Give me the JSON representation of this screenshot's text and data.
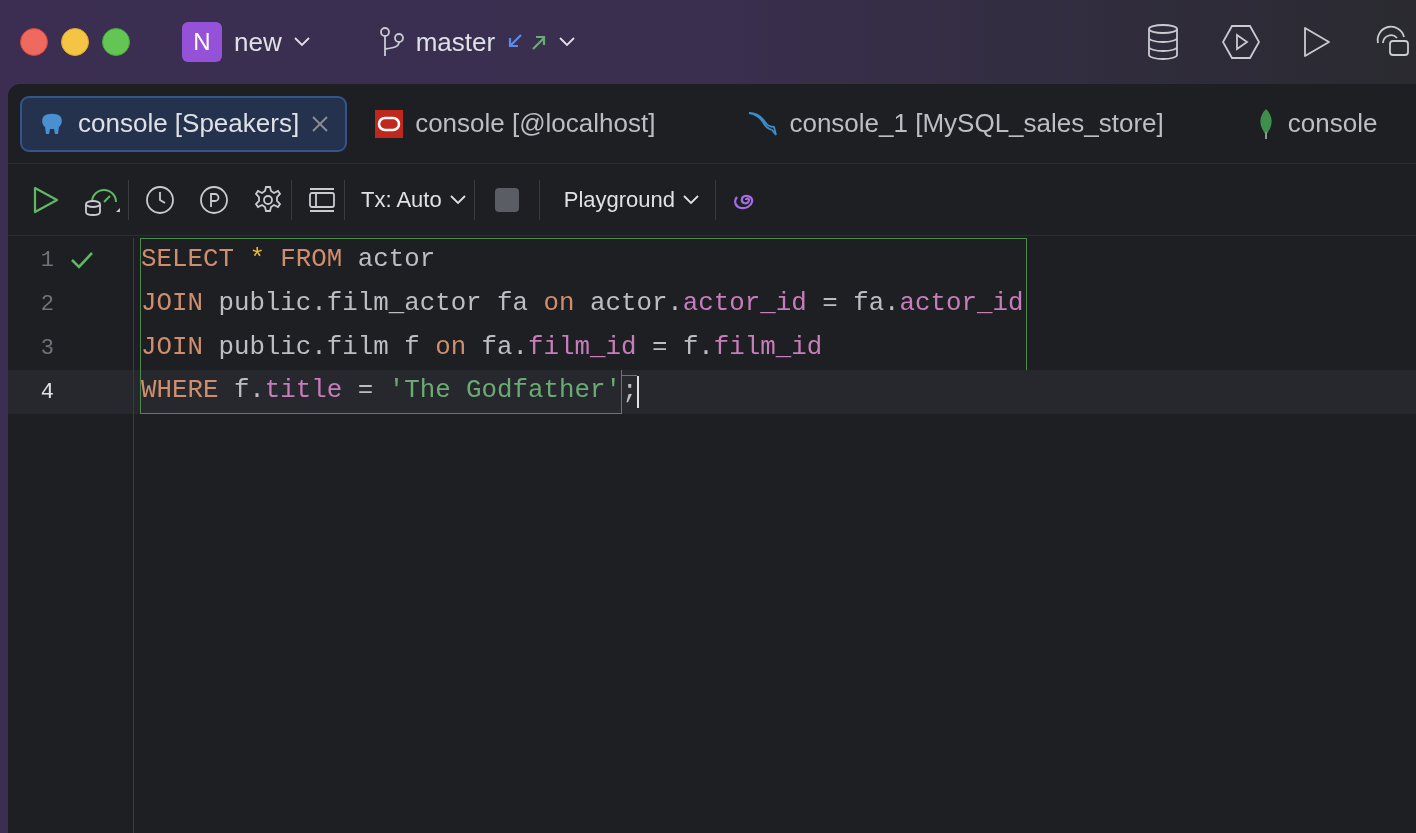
{
  "project": {
    "initial": "N",
    "name": "new"
  },
  "branch": {
    "name": "master"
  },
  "tabs": [
    {
      "label": "console [Speakers]",
      "kind": "postgres",
      "selected": true
    },
    {
      "label": "console [@localhost]",
      "kind": "oracle",
      "selected": false
    },
    {
      "label": "console_1 [MySQL_sales_store]",
      "kind": "mysql",
      "selected": false
    },
    {
      "label": "console",
      "kind": "mongo",
      "selected": false
    }
  ],
  "toolbar": {
    "transaction": "Tx: Auto",
    "mode": "Playground"
  },
  "lines": [
    {
      "number": "1",
      "checked": true,
      "current": false,
      "outlined": true,
      "tokens": [
        {
          "text": "SELECT ",
          "kind": "keyword"
        },
        {
          "text": "* ",
          "kind": "star"
        },
        {
          "text": "FROM",
          "kind": "keyword"
        },
        {
          "text": " actor",
          "kind": "plain"
        }
      ]
    },
    {
      "number": "2",
      "checked": false,
      "current": false,
      "outlined": true,
      "tokens": [
        {
          "text": "JOIN",
          "kind": "keyword"
        },
        {
          "text": " public.film_actor fa ",
          "kind": "plain"
        },
        {
          "text": "on",
          "kind": "keyword"
        },
        {
          "text": " actor.",
          "kind": "plain"
        },
        {
          "text": "actor_id",
          "kind": "field"
        },
        {
          "text": " = fa.",
          "kind": "plain"
        },
        {
          "text": "actor_id",
          "kind": "field"
        }
      ]
    },
    {
      "number": "3",
      "checked": false,
      "current": false,
      "outlined": true,
      "tokens": [
        {
          "text": "JOIN",
          "kind": "keyword"
        },
        {
          "text": " public.film f ",
          "kind": "plain"
        },
        {
          "text": "on",
          "kind": "keyword"
        },
        {
          "text": " fa.",
          "kind": "plain"
        },
        {
          "text": "film_id",
          "kind": "field"
        },
        {
          "text": " = f.",
          "kind": "plain"
        },
        {
          "text": "film_id",
          "kind": "field"
        }
      ]
    },
    {
      "number": "4",
      "checked": false,
      "current": true,
      "outlined": true,
      "tokens": [
        {
          "text": "WHERE",
          "kind": "keyword"
        },
        {
          "text": " f.",
          "kind": "plain"
        },
        {
          "text": "title",
          "kind": "field"
        },
        {
          "text": " = ",
          "kind": "plain"
        },
        {
          "text": "'The Godfather'",
          "kind": "string"
        },
        {
          "text": ";",
          "kind": "terminator"
        }
      ]
    }
  ]
}
